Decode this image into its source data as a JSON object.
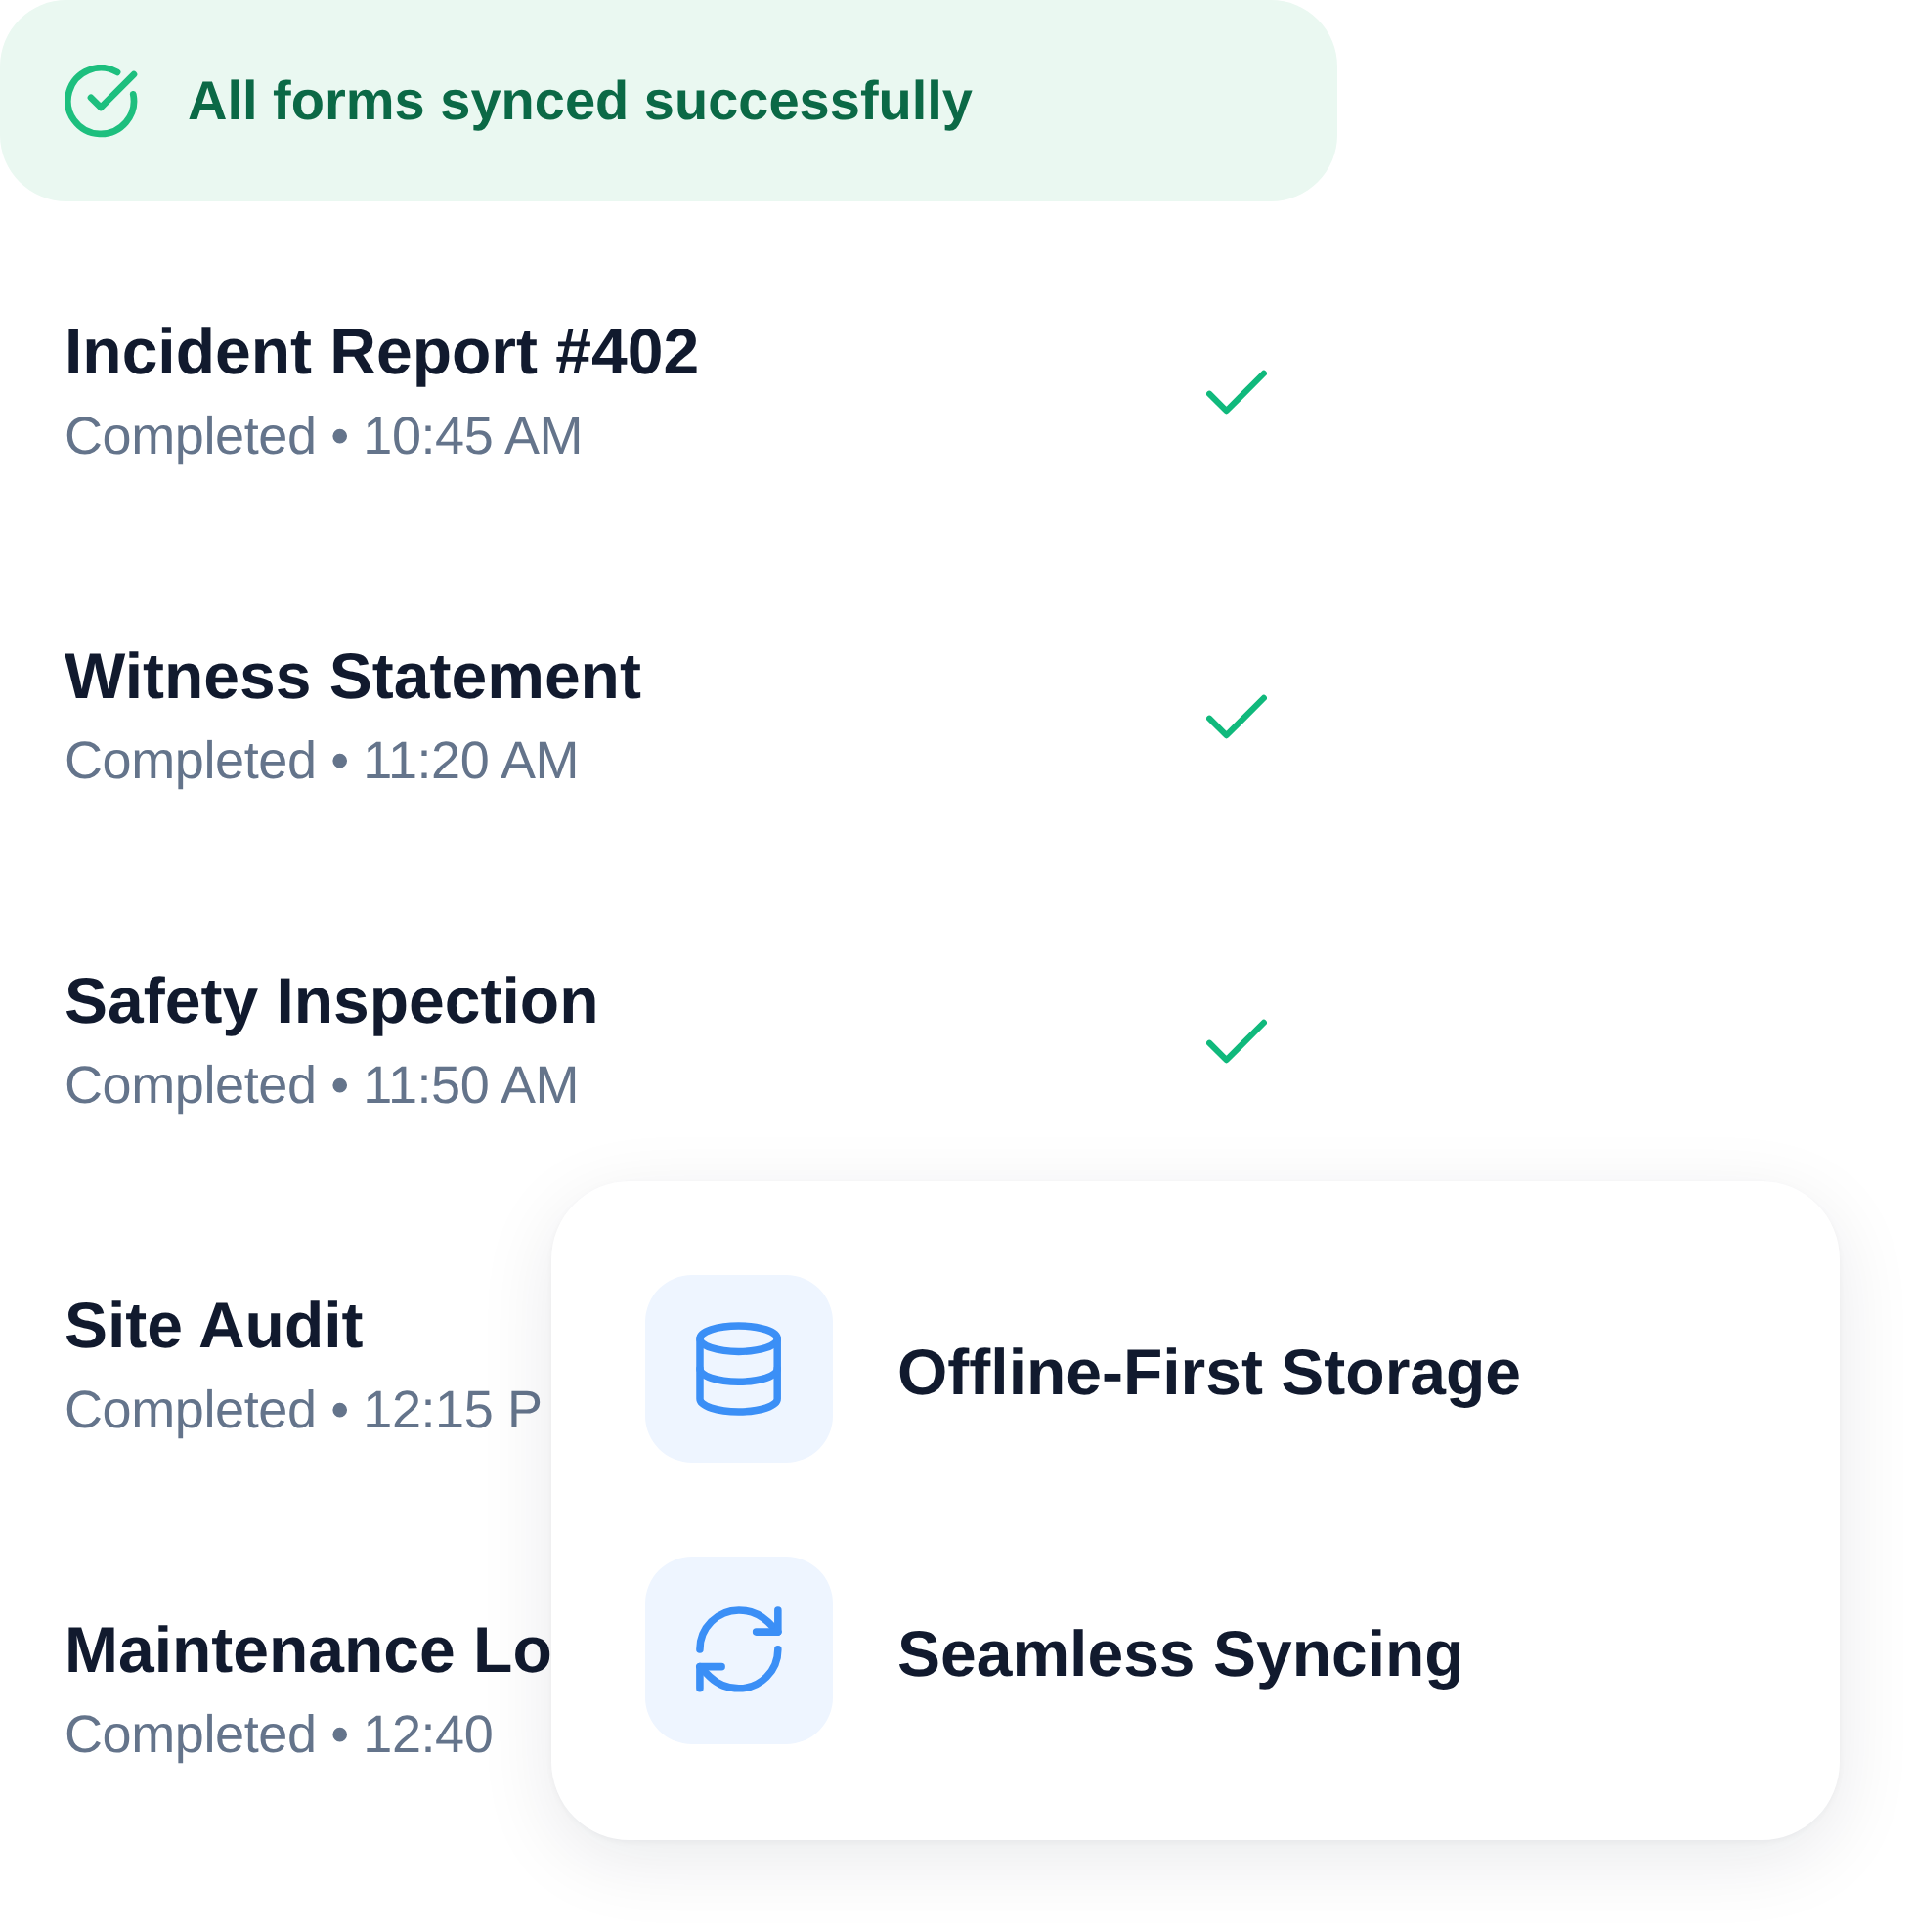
{
  "banner": {
    "text": "All forms synced successfully"
  },
  "forms": [
    {
      "title": "Incident Report #402",
      "status": "Completed • 10:45 AM",
      "checkmark": true
    },
    {
      "title": "Witness Statement",
      "status": "Completed • 11:20 AM",
      "checkmark": true
    },
    {
      "title": "Safety Inspection",
      "status": "Completed • 11:50 AM",
      "checkmark": true
    },
    {
      "title": "Site Audit",
      "status": "Completed • 12:15 P",
      "checkmark": false
    },
    {
      "title": "Maintenance Lo",
      "status": "Completed • 12:40",
      "checkmark": false
    }
  ],
  "feature_card": {
    "features": [
      {
        "label": "Offline-First Storage"
      },
      {
        "label": "Seamless Syncing"
      }
    ]
  }
}
